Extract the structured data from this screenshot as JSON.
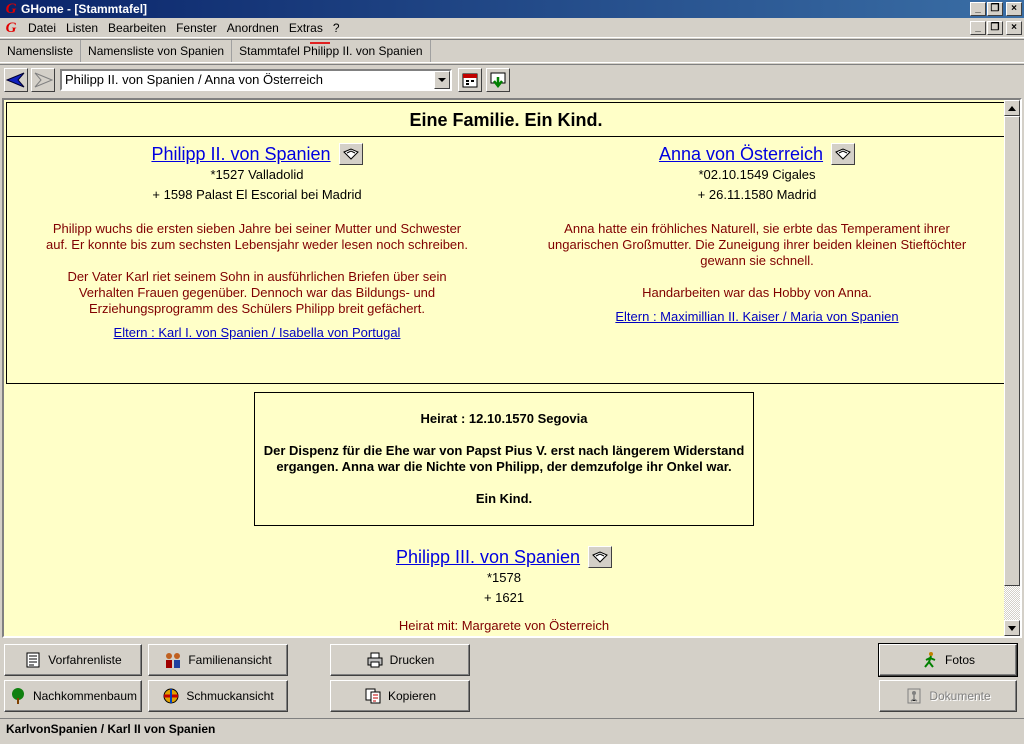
{
  "window": {
    "title": "GHome - [Stammtafel]"
  },
  "menu": [
    "Datei",
    "Listen",
    "Bearbeiten",
    "Fenster",
    "Anordnen",
    "Extras",
    "?"
  ],
  "tabs": [
    "Namensliste",
    "Namensliste von Spanien",
    "Stammtafel Philipp II. von Spanien"
  ],
  "nav": {
    "combo_value": "Philipp II. von Spanien /  Anna von Österreich"
  },
  "content": {
    "heading": "Eine Familie. Ein Kind.",
    "father": {
      "name": "Philipp II. von Spanien",
      "born": "*1527 Valladolid",
      "died": "+ 1598 Palast El Escorial bei Madrid",
      "bio1": "Philipp wuchs die ersten sieben Jahre bei seiner Mutter und Schwester auf. Er konnte bis zum sechsten Lebensjahr weder lesen noch schreiben.",
      "bio2": "Der Vater Karl riet seinem Sohn in ausführlichen Briefen über sein Verhalten Frauen gegenüber. Dennoch war das Bildungs- und Erziehungsprogramm des Schülers Philipp breit gefächert.",
      "parents": "Eltern : Karl I. von Spanien / Isabella von Portugal"
    },
    "mother": {
      "name": "Anna von Österreich",
      "born": "*02.10.1549 Cigales",
      "died": "+ 26.11.1580 Madrid",
      "bio1": "Anna hatte ein fröhliches Naturell, sie erbte das Temperament ihrer ungarischen Großmutter. Die Zuneigung ihrer beiden kleinen Stieftöchter gewann sie schnell.",
      "bio2": "Handarbeiten war das Hobby von Anna.",
      "parents": "Eltern : Maximillian II. Kaiser / Maria von Spanien"
    },
    "marriage": {
      "line1": "Heirat : 12.10.1570 Segovia",
      "line2": "Der Dispenz für die Ehe war von Papst Pius V. erst nach längerem Widerstand ergangen. Anna war die Nichte von Philipp, der demzufolge ihr Onkel war.",
      "line3": "Ein Kind."
    },
    "child": {
      "name": "Philipp III. von Spanien",
      "born": "*1578",
      "died": "+ 1621",
      "marriage_partial": "Heirat mit: Margarete von Österreich"
    }
  },
  "buttons": {
    "vorfahrenliste": "Vorfahrenliste",
    "familienansicht": "Familienansicht",
    "drucken": "Drucken",
    "fotos": "Fotos",
    "nachkommenbaum": "Nachkommenbaum",
    "schmuckansicht": "Schmuckansicht",
    "kopieren": "Kopieren",
    "dokumente": "Dokumente"
  },
  "status": "KarlvonSpanien / Karl II von Spanien"
}
